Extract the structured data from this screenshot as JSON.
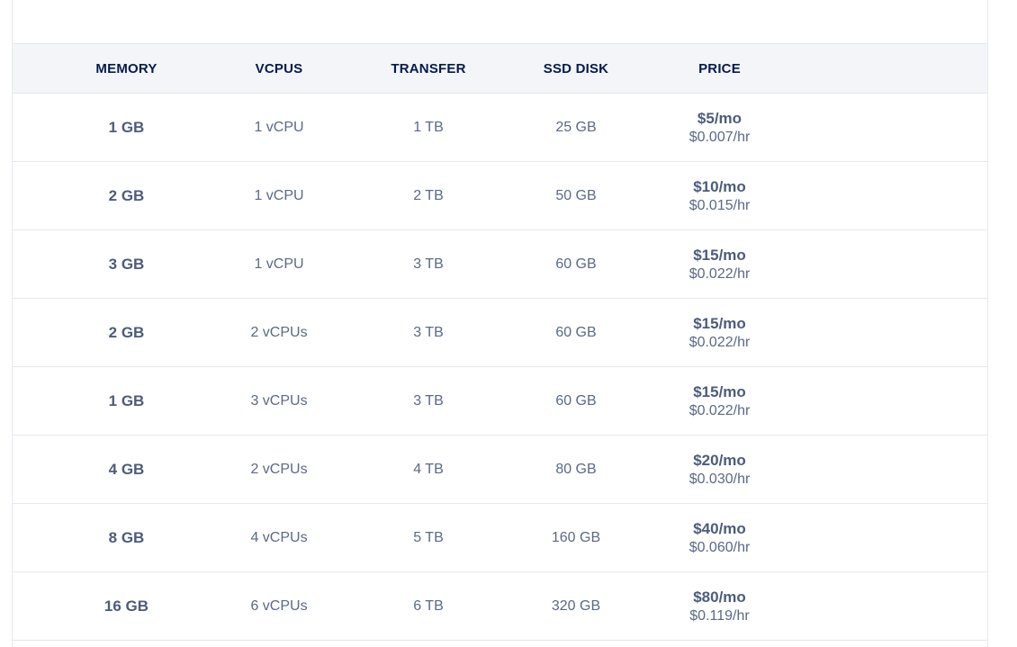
{
  "pricing_table": {
    "headers": {
      "memory": "MEMORY",
      "vcpus": "VCPUS",
      "transfer": "TRANSFER",
      "ssd_disk": "SSD DISK",
      "price": "PRICE"
    },
    "rows": [
      {
        "memory": "1 GB",
        "vcpus": "1 vCPU",
        "transfer": "1 TB",
        "ssd_disk": "25 GB",
        "price_mo": "$5/mo",
        "price_hr": "$0.007/hr"
      },
      {
        "memory": "2 GB",
        "vcpus": "1 vCPU",
        "transfer": "2 TB",
        "ssd_disk": "50 GB",
        "price_mo": "$10/mo",
        "price_hr": "$0.015/hr"
      },
      {
        "memory": "3 GB",
        "vcpus": "1 vCPU",
        "transfer": "3 TB",
        "ssd_disk": "60 GB",
        "price_mo": "$15/mo",
        "price_hr": "$0.022/hr"
      },
      {
        "memory": "2 GB",
        "vcpus": "2 vCPUs",
        "transfer": "3 TB",
        "ssd_disk": "60 GB",
        "price_mo": "$15/mo",
        "price_hr": "$0.022/hr"
      },
      {
        "memory": "1 GB",
        "vcpus": "3 vCPUs",
        "transfer": "3 TB",
        "ssd_disk": "60 GB",
        "price_mo": "$15/mo",
        "price_hr": "$0.022/hr"
      },
      {
        "memory": "4 GB",
        "vcpus": "2 vCPUs",
        "transfer": "4 TB",
        "ssd_disk": "80 GB",
        "price_mo": "$20/mo",
        "price_hr": "$0.030/hr"
      },
      {
        "memory": "8 GB",
        "vcpus": "4 vCPUs",
        "transfer": "5 TB",
        "ssd_disk": "160 GB",
        "price_mo": "$40/mo",
        "price_hr": "$0.060/hr"
      },
      {
        "memory": "16 GB",
        "vcpus": "6 vCPUs",
        "transfer": "6 TB",
        "ssd_disk": "320 GB",
        "price_mo": "$80/mo",
        "price_hr": "$0.119/hr"
      }
    ]
  },
  "colors": {
    "header_bg": "#f3f5f9",
    "header_text": "#031b4e",
    "body_text": "#5b6987",
    "border": "#e5e8ed"
  }
}
